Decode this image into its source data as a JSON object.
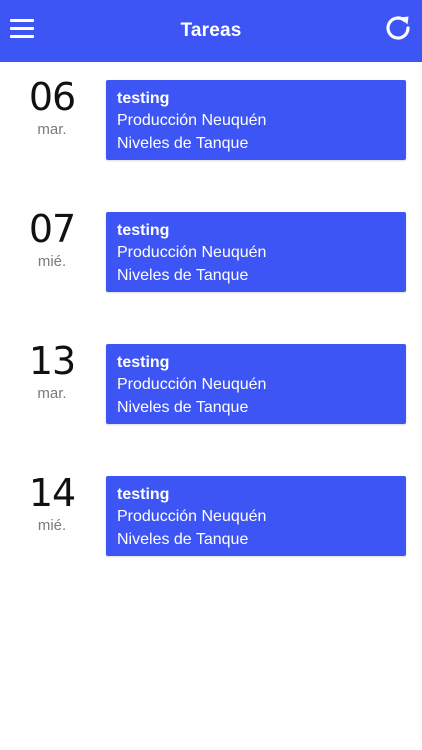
{
  "app_bar": {
    "title": "Tareas",
    "menu_icon": "hamburger-menu-icon",
    "refresh_icon": "refresh-icon",
    "color": "#3d55f5"
  },
  "tasks": [
    {
      "day": "06",
      "weekday": "mar.",
      "title": "testing",
      "line1": "Producción Neuquén",
      "line2": "Niveles de Tanque"
    },
    {
      "day": "07",
      "weekday": "mié.",
      "title": "testing",
      "line1": "Producción Neuquén",
      "line2": "Niveles de Tanque"
    },
    {
      "day": "13",
      "weekday": "mar.",
      "title": "testing",
      "line1": "Producción Neuquén",
      "line2": "Niveles de Tanque"
    },
    {
      "day": "14",
      "weekday": "mié.",
      "title": "testing",
      "line1": "Producción Neuquén",
      "line2": "Niveles de Tanque"
    }
  ]
}
